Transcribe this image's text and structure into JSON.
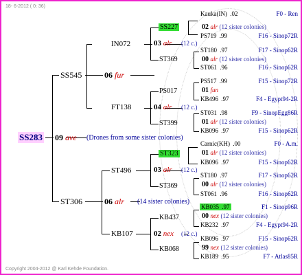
{
  "meta": {
    "date": "18- 6-2012 ( 0: 36)",
    "copyright": "Copyright 2004-2012 @ Karl Kehde Foundation."
  },
  "root": {
    "name": "SS283",
    "year": "09",
    "code": "ave",
    "note": "(Drones from some sister colonies)"
  },
  "g1": [
    {
      "name": "SS545",
      "year": "06",
      "code": "fur"
    },
    {
      "name": "ST306",
      "year": "06",
      "code": "alr",
      "note": "(14 sister colonies)"
    }
  ],
  "g2": [
    {
      "name": "IN072"
    },
    {
      "name": "FT138"
    },
    {
      "name": "ST496"
    },
    {
      "name": "KB107"
    }
  ],
  "g3": [
    {
      "name": "SS227",
      "year": "03",
      "code": "alr",
      "note": "(12 c.)"
    },
    {
      "name": "ST369"
    },
    {
      "name": "PS017",
      "year": "04",
      "code": "alr",
      "note": "(12 c.)"
    },
    {
      "name": "ST399"
    },
    {
      "name": "ST323",
      "year": "03",
      "code": "alr",
      "note": "(12 c.)"
    },
    {
      "name": "ST369"
    },
    {
      "name": "KB437",
      "year": "02",
      "code": "nex",
      "note": "(12 c.)"
    },
    {
      "name": "KB068"
    }
  ],
  "rows": [
    {
      "kind": "queen",
      "name": "Kauka(IN)",
      "year": ".02",
      "origin": "F0 - Ren"
    },
    {
      "kind": "mating",
      "year": "02",
      "code": "alr",
      "note": "(12 sister colonies)"
    },
    {
      "kind": "queen",
      "name": "PS719",
      "year": ".99",
      "origin": "F16 - Sinop72R"
    },
    {
      "kind": "queen",
      "name": "ST180",
      "year": ".97",
      "origin": "F17 - Sinop62R"
    },
    {
      "kind": "mating",
      "year": "00",
      "code": "alr",
      "note": "(12 sister colonies)"
    },
    {
      "kind": "queen",
      "name": "ST061",
      "year": ".96",
      "origin": "F16 - Sinop62R"
    },
    {
      "kind": "queen",
      "name": "PS517",
      "year": ".99",
      "origin": "F15 - Sinop72R"
    },
    {
      "kind": "mating",
      "year": "01",
      "code": "fun",
      "note": ""
    },
    {
      "kind": "queen",
      "name": "KB496",
      "year": ".97",
      "origin": "F4 - Egypt94-2R"
    },
    {
      "kind": "queen",
      "name": "ST031",
      "year": ".98",
      "origin": "F9 - SinopEgg86R"
    },
    {
      "kind": "mating",
      "year": "01",
      "code": "alr",
      "note": "(12 sister colonies)"
    },
    {
      "kind": "queen",
      "name": "KB096",
      "year": ".97",
      "origin": "F15 - Sinop62R"
    },
    {
      "kind": "queen",
      "name": "Carnic(KH)",
      "year": ".00",
      "origin": "F0 - A.m."
    },
    {
      "kind": "mating",
      "year": "01",
      "code": "alr",
      "note": "(12 sister colonies)"
    },
    {
      "kind": "queen",
      "name": "KB096",
      "year": ".97",
      "origin": "F15 - Sinop62R"
    },
    {
      "kind": "queen",
      "name": "ST180",
      "year": ".97",
      "origin": "F17 - Sinop62R"
    },
    {
      "kind": "mating",
      "year": "00",
      "code": "alr",
      "note": "(12 sister colonies)"
    },
    {
      "kind": "queen",
      "name": "ST061",
      "year": ".96",
      "origin": "F16 - Sinop62R"
    },
    {
      "kind": "queen",
      "name": "KB035",
      "year": ".97",
      "origin": "F1 - Sinop96R",
      "highlight": true
    },
    {
      "kind": "mating",
      "year": "00",
      "code": "nex",
      "note": "(12 sister colonies)"
    },
    {
      "kind": "queen",
      "name": "KB232",
      "year": ".97",
      "origin": "F4 - Egypt94-2R"
    },
    {
      "kind": "queen",
      "name": "KB096",
      "year": ".97",
      "origin": "F15 - Sinop62R"
    },
    {
      "kind": "mating",
      "year": "99",
      "code": "nex",
      "note": "(12 sister colonies)"
    },
    {
      "kind": "queen",
      "name": "KB189",
      "year": ".95",
      "origin": "F7 - Atlas85R"
    }
  ],
  "colors": {
    "frame": "#ee22cc",
    "highlight": "#33dd33",
    "root_bg": "#ffd0ff",
    "code": "#cc0000",
    "origin": "#000099"
  }
}
